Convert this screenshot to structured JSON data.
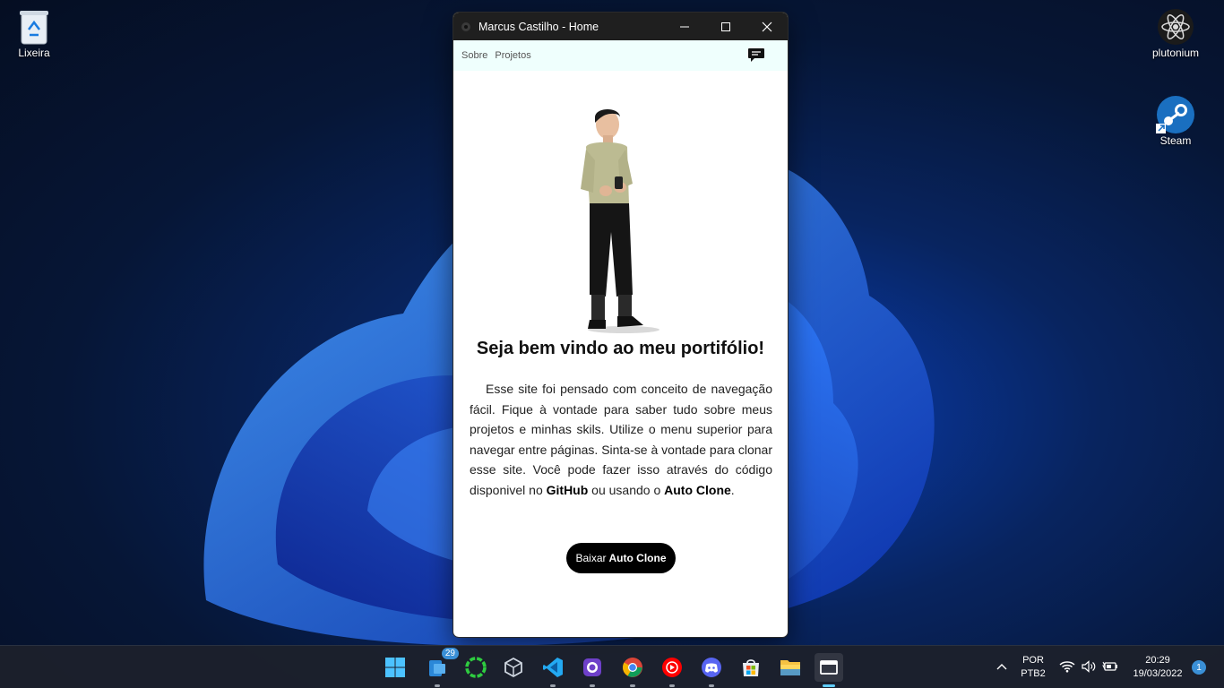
{
  "desktop": {
    "icons": [
      {
        "label": "Lixeira"
      },
      {
        "label": "plutonium"
      },
      {
        "label": "Steam"
      }
    ]
  },
  "window": {
    "title": "Marcus Castilho - Home",
    "nav": {
      "links": [
        "Sobre",
        "Projetos"
      ]
    },
    "heading": "Seja bem vindo ao meu portifólio!",
    "paragraph": {
      "text_1": "Esse site foi pensado com conceito de navegação fácil. Fique à vontade para saber tudo sobre meus projetos e minhas skils. Utilize o menu superior para navegar entre páginas. Sinta-se à vontade para clonar esse site. Você pode fazer isso através do código disponivel no ",
      "github": "GitHub",
      "text_2": " ou usando o ",
      "autoclone": "Auto Clone",
      "text_3": "."
    },
    "button": {
      "prefix": "Baixar",
      "bold": "Auto Clone"
    }
  },
  "taskbar": {
    "mail_badge": "29",
    "language": "POR",
    "keyboard": "PTB2",
    "time": "20:29",
    "date": "19/03/2022",
    "notification_count": "1"
  },
  "colors": {
    "accent": "#60cdff",
    "nav_bg": "#effffd",
    "button_bg": "#000000"
  }
}
